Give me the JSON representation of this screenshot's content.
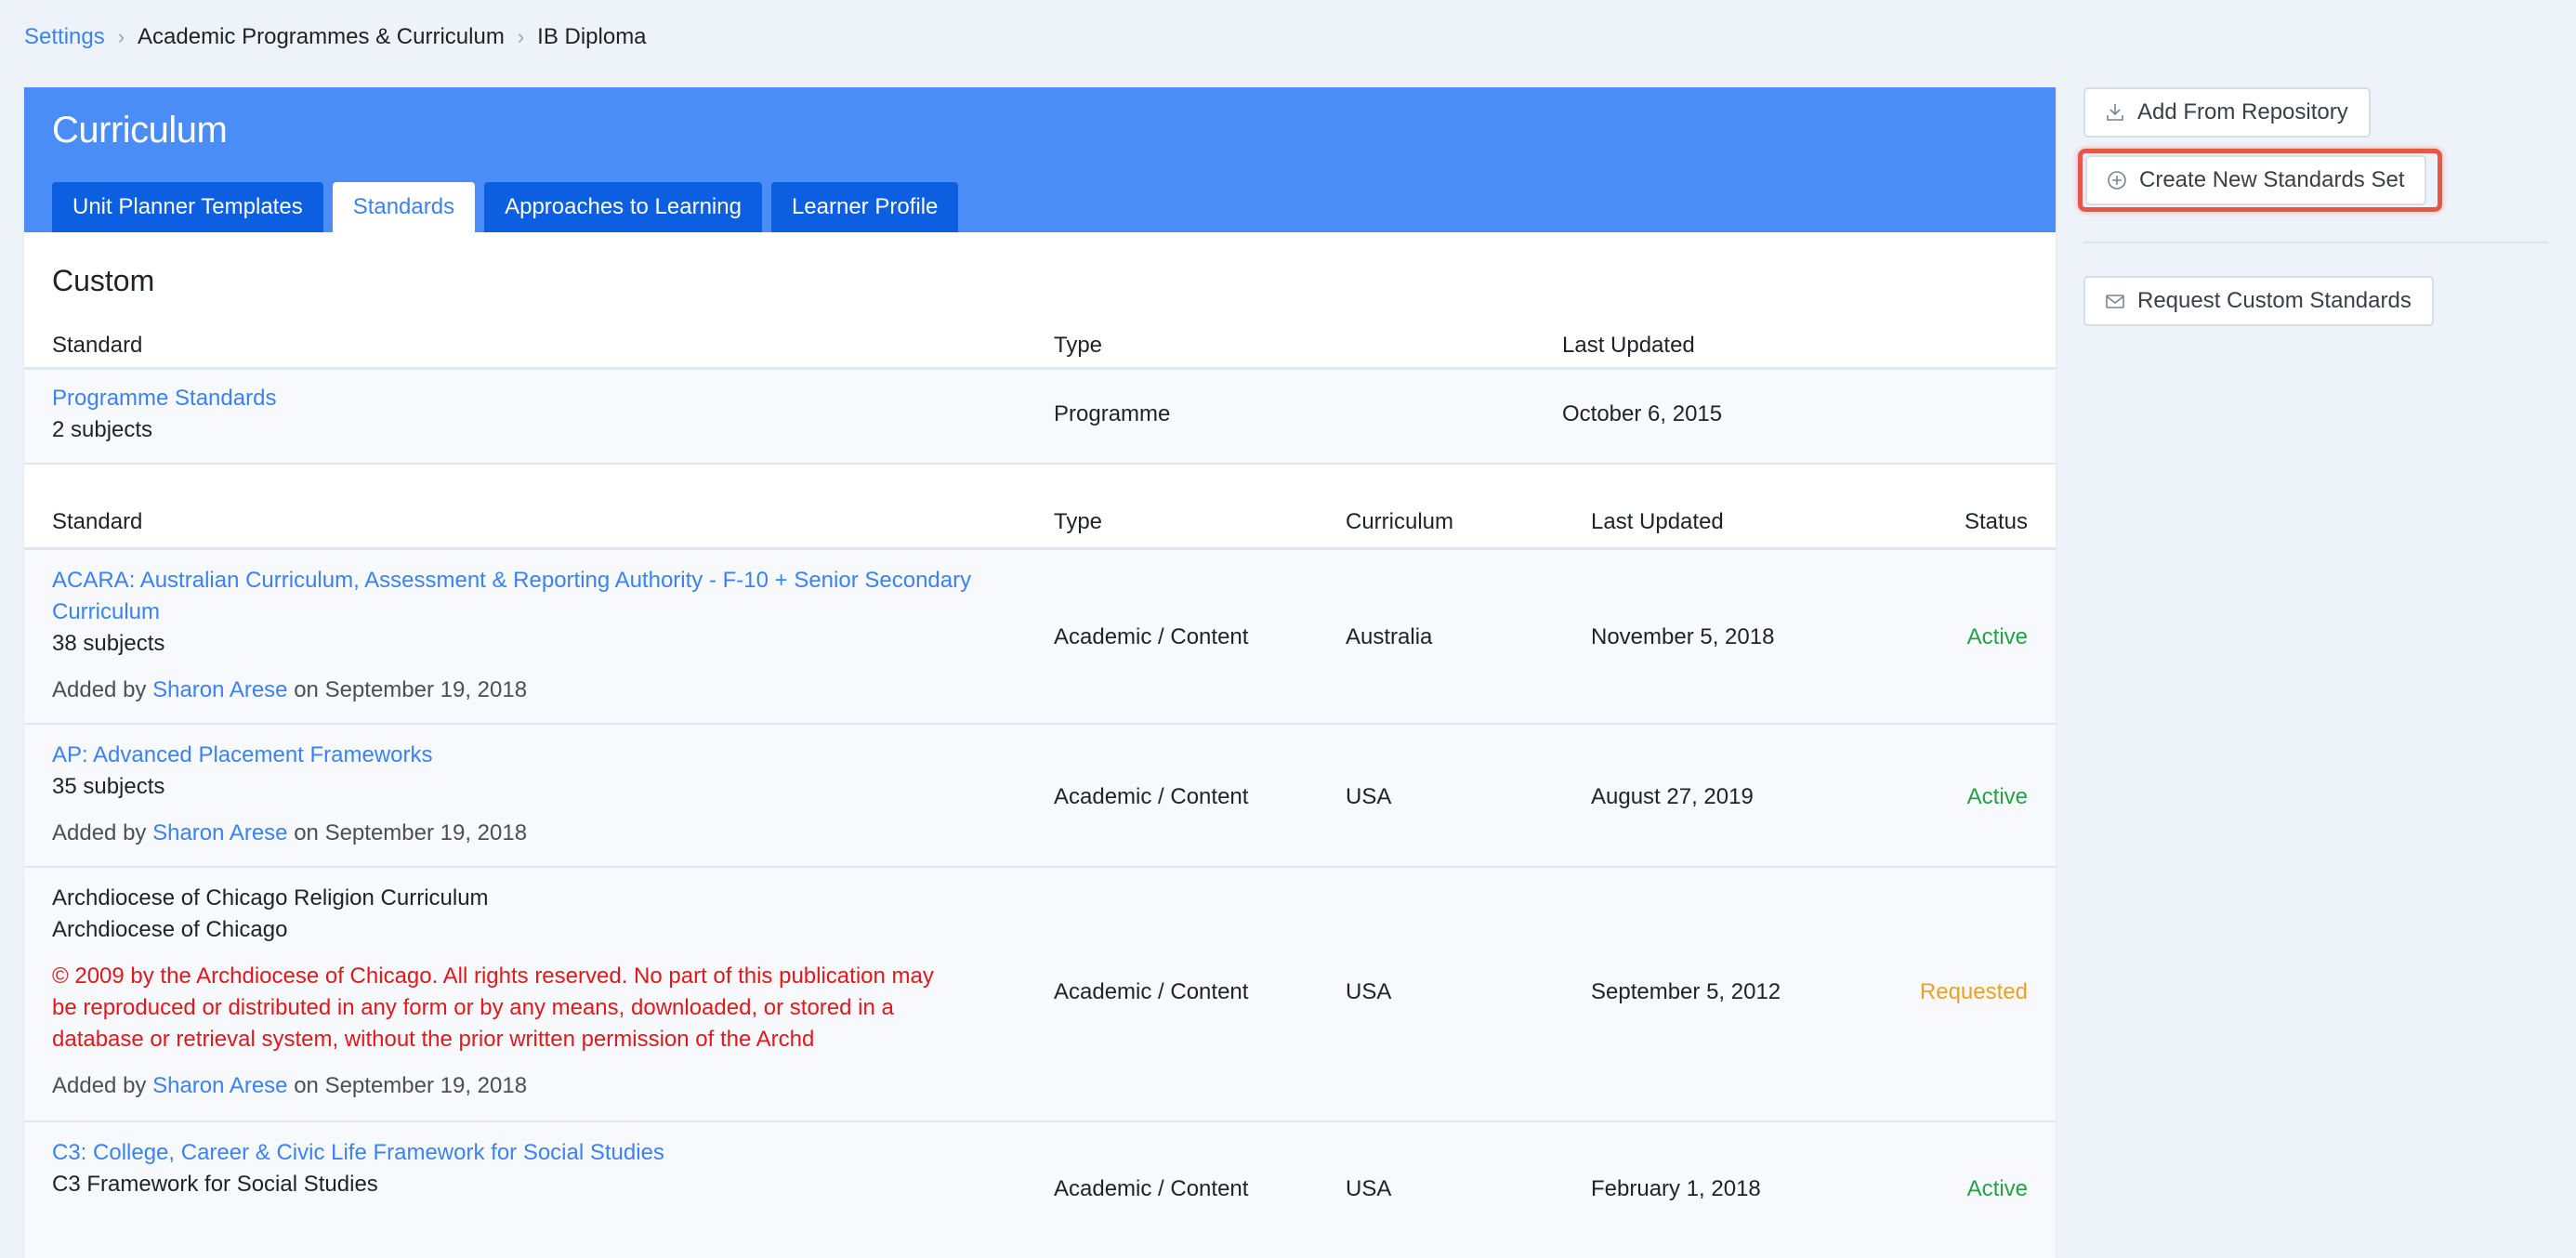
{
  "breadcrumb": {
    "settings": "Settings",
    "programmes": "Academic Programmes & Curriculum",
    "current": "IB Diploma"
  },
  "panel": {
    "title": "Curriculum",
    "tabs": [
      "Unit Planner Templates",
      "Standards",
      "Approaches to Learning",
      "Learner Profile"
    ],
    "active_tab": "Standards"
  },
  "custom": {
    "section_title": "Custom",
    "headers": {
      "standard": "Standard",
      "type": "Type",
      "last_updated": "Last Updated"
    },
    "rows": [
      {
        "name": "Programme Standards",
        "subjects": "2 subjects",
        "type": "Programme",
        "last_updated": "October 6, 2015"
      }
    ]
  },
  "standards": {
    "headers": {
      "standard": "Standard",
      "type": "Type",
      "curriculum": "Curriculum",
      "last_updated": "Last Updated",
      "status": "Status"
    },
    "added_by_prefix": "Added by",
    "on_word": "on",
    "rows": [
      {
        "name_line1": "ACARA: Australian Curriculum, Assessment & Reporting Authority - F-10 + Senior Secondary",
        "name_line2": "Curriculum",
        "subjects": "38 subjects",
        "added_by": "Sharon Arese",
        "added_on": "September 19, 2018",
        "type": "Academic / Content",
        "curriculum": "Australia",
        "last_updated": "November 5, 2018",
        "status": "Active"
      },
      {
        "name": "AP: Advanced Placement Frameworks",
        "subjects": "35 subjects",
        "added_by": "Sharon Arese",
        "added_on": "September 19, 2018",
        "type": "Academic / Content",
        "curriculum": "USA",
        "last_updated": "August 27, 2019",
        "status": "Active"
      },
      {
        "name": "Archdiocese of Chicago Religion Curriculum",
        "subtitle": "Archdiocese of Chicago",
        "copyright_line1": "© 2009 by the Archdiocese of Chicago. All rights reserved. No part of this publication may",
        "copyright_line2": "be reproduced or distributed in any form or by any means, downloaded, or stored in a",
        "copyright_line3": "database or retrieval system, without the prior written permission of the Archd",
        "added_by": "Sharon Arese",
        "added_on": "September 19, 2018",
        "type": "Academic / Content",
        "curriculum": "USA",
        "last_updated": "September 5, 2012",
        "status": "Requested"
      },
      {
        "name": "C3: College, Career & Civic Life Framework for Social Studies",
        "subtitle": "C3 Framework for Social Studies",
        "type": "Academic / Content",
        "curriculum": "USA",
        "last_updated": "February 1, 2018",
        "status": "Active"
      }
    ]
  },
  "sidebar": {
    "add_from_repository": "Add From Repository",
    "create_new_set": "Create New Standards Set",
    "request_custom": "Request Custom Standards"
  },
  "colors": {
    "header_blue": "#4a8df6",
    "tab_blue": "#0b5fe0",
    "link_blue": "#3b82f6",
    "active_green": "#21a346",
    "requested_orange": "#f0a020",
    "copyright_red": "#e0191c",
    "highlight_red": "#e8564a"
  }
}
